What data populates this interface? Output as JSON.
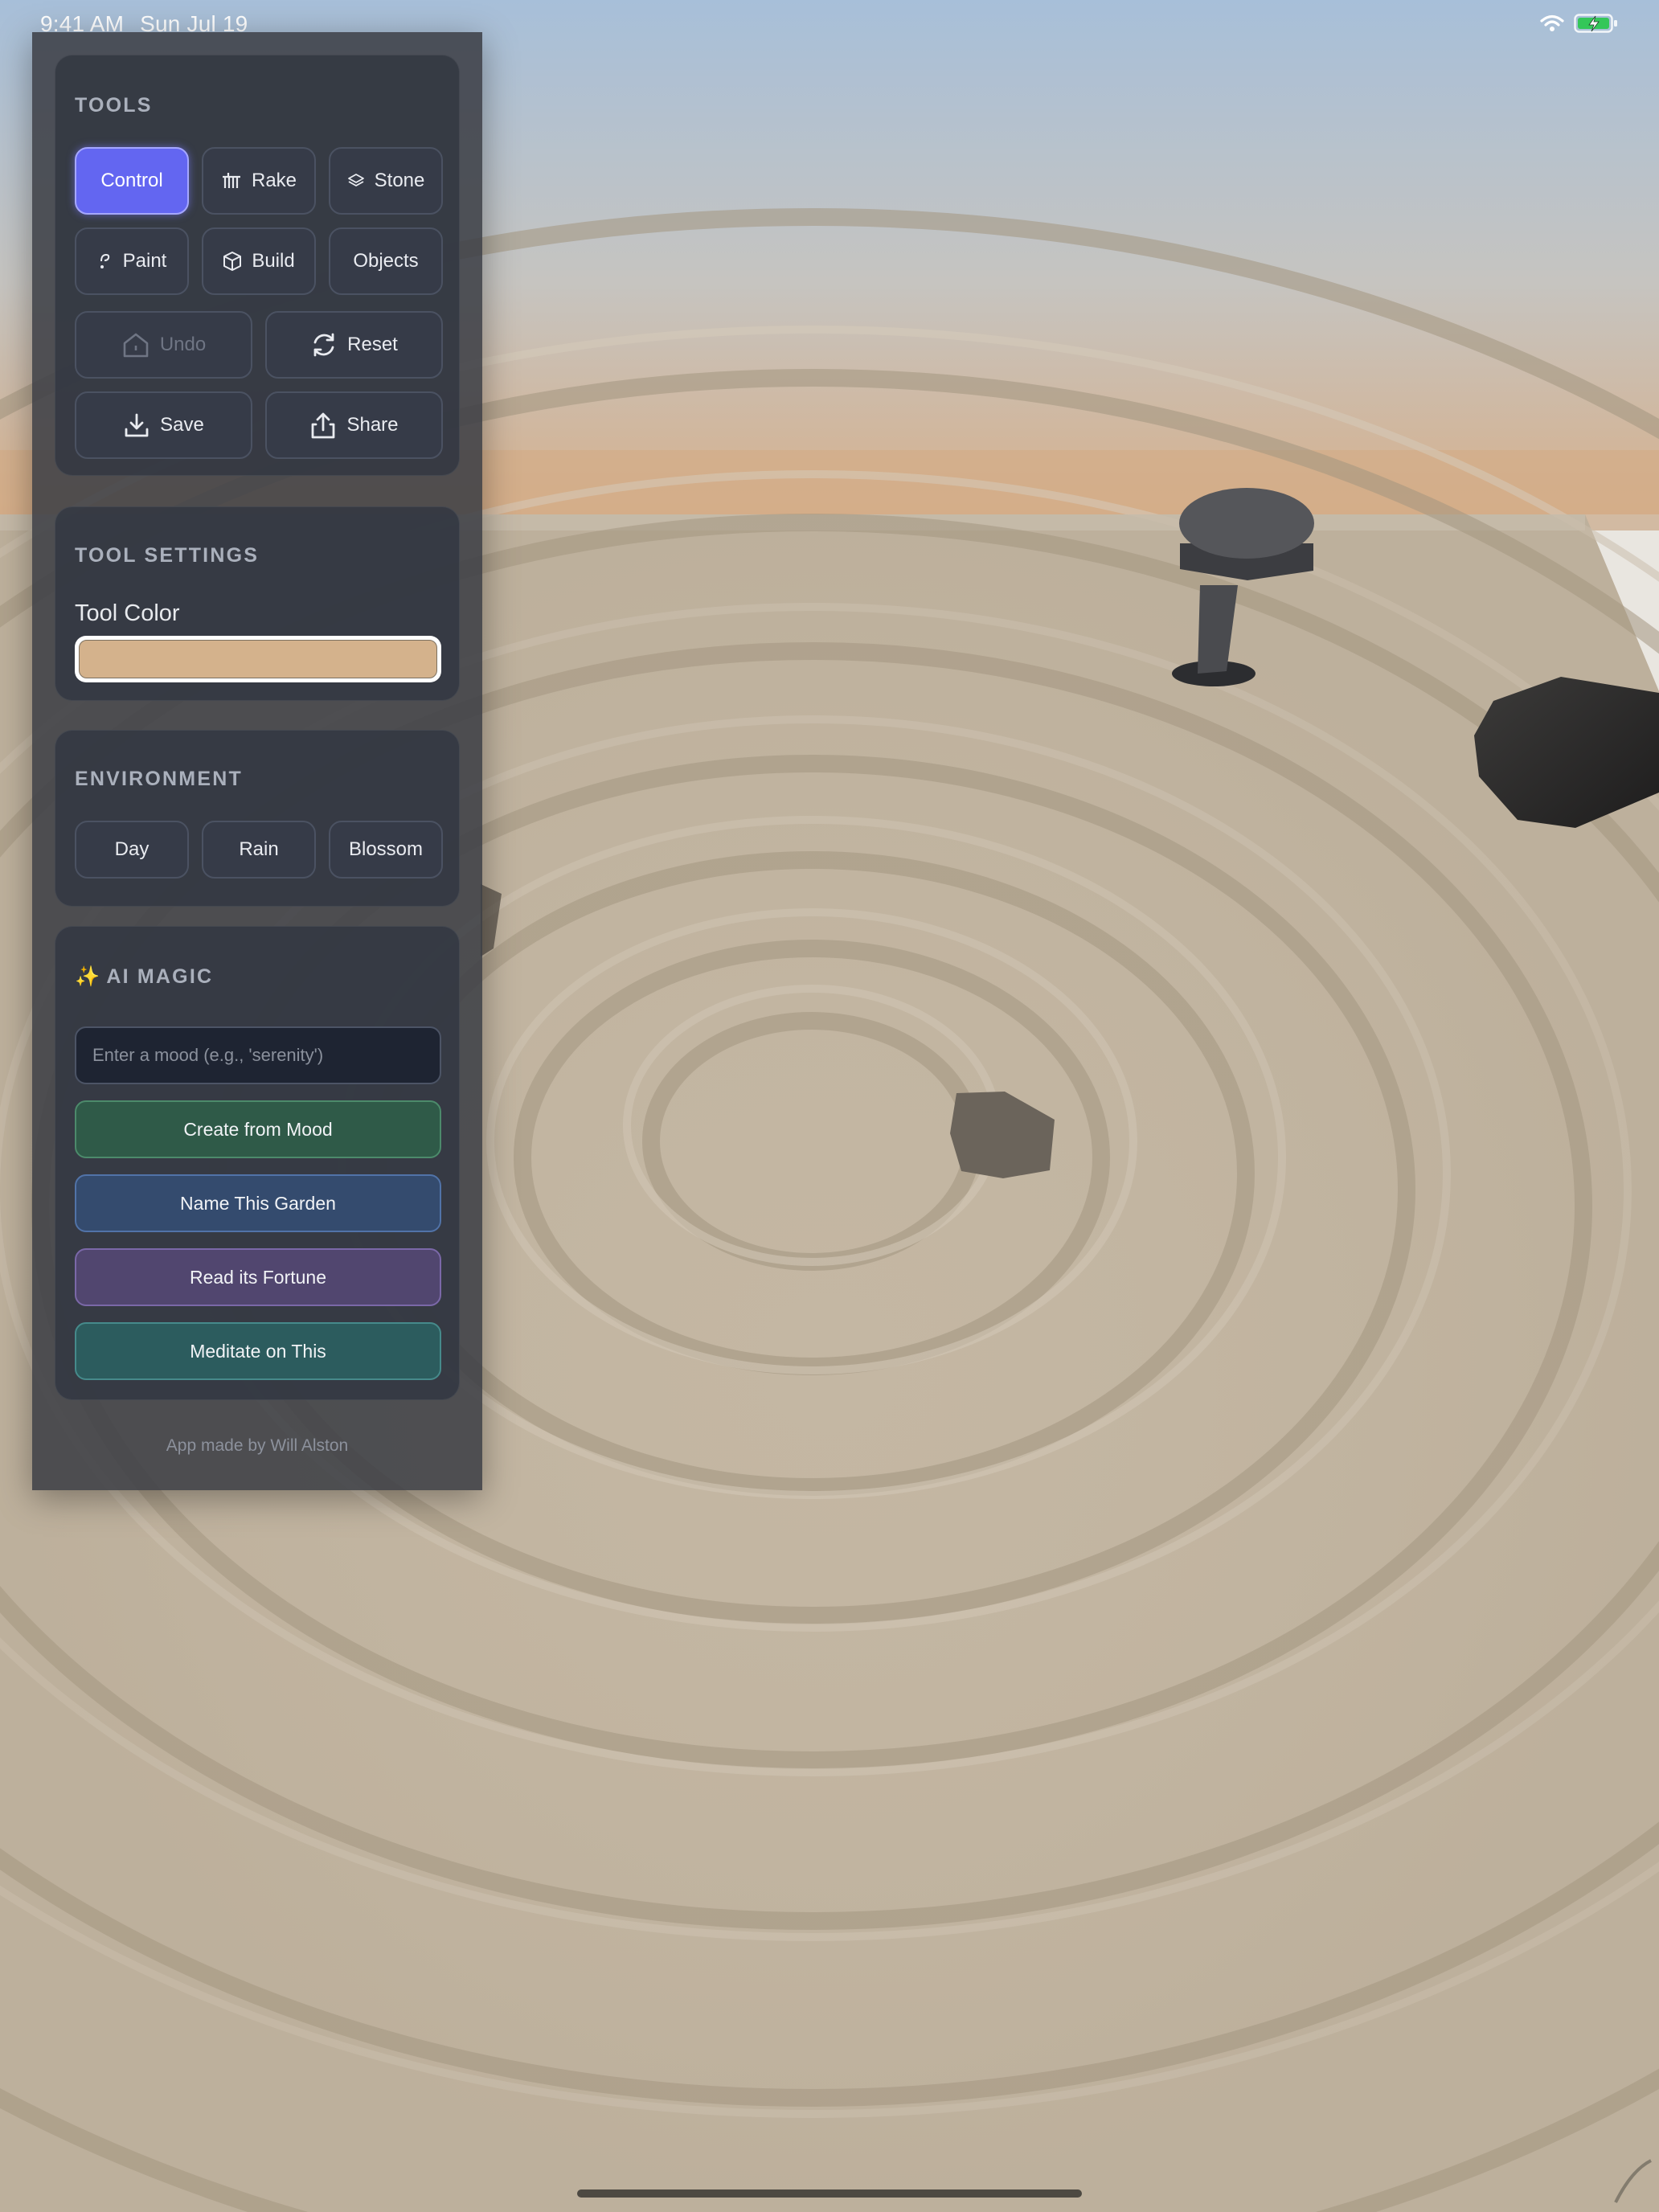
{
  "status_bar": {
    "time": "9:41 AM",
    "date": "Sun Jul 19"
  },
  "tools": {
    "title": "TOOLS",
    "buttons": {
      "control": "Control",
      "rake": "Rake",
      "stone": "Stone",
      "paint": "Paint",
      "build": "Build",
      "objects": "Objects",
      "undo": "Undo",
      "reset": "Reset",
      "save": "Save",
      "share": "Share"
    },
    "active_tool": "Control"
  },
  "tool_settings": {
    "title": "TOOL SETTINGS",
    "color_label": "Tool Color",
    "color_value": "#d4b28c"
  },
  "environment": {
    "title": "ENVIRONMENT",
    "options": {
      "day": "Day",
      "rain": "Rain",
      "blossom": "Blossom"
    }
  },
  "ai_magic": {
    "icon": "✨",
    "title": "AI MAGIC",
    "mood_placeholder": "Enter a mood (e.g., 'serenity')",
    "mood_value": "",
    "buttons": {
      "create": "Create from Mood",
      "name": "Name This Garden",
      "fortune": "Read its Fortune",
      "meditate": "Meditate on This"
    }
  },
  "footer": {
    "credit": "App made by Will Alston"
  },
  "colors": {
    "accent": "#6366f1",
    "sand": "#c4b7a3",
    "sky_top": "#a7bfd9",
    "sky_bottom": "#d6b08c",
    "create_button": "#2f5a48",
    "name_button": "#344b6e",
    "fortune_button": "#51466f",
    "meditate_button": "#2c5c5e"
  }
}
